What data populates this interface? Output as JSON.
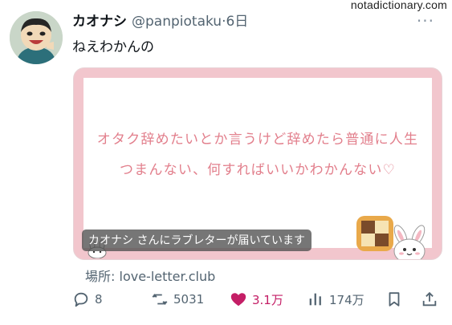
{
  "watermark": "notadictionary.com",
  "tweet": {
    "display_name": "カオナシ",
    "handle": "@panpiotaku",
    "time": "·6日",
    "text": "ねえわかんの",
    "more_label": "···"
  },
  "card": {
    "line1": "オタク辞めたいとか言うけど辞めたら普通に人生",
    "line2": "つまんない、何すればいいかわかんない♡",
    "caption": "カオナシ さんにラブレターが届いています",
    "source_prefix": "場所:",
    "source_domain": "love-letter.club"
  },
  "actions": {
    "replies": "8",
    "retweets": "5031",
    "likes": "3.1万",
    "views": "174万"
  },
  "colors": {
    "card_border": "#f2c6cd",
    "card_text": "#e27f8c",
    "like": "#c41e66",
    "muted": "#536471"
  }
}
